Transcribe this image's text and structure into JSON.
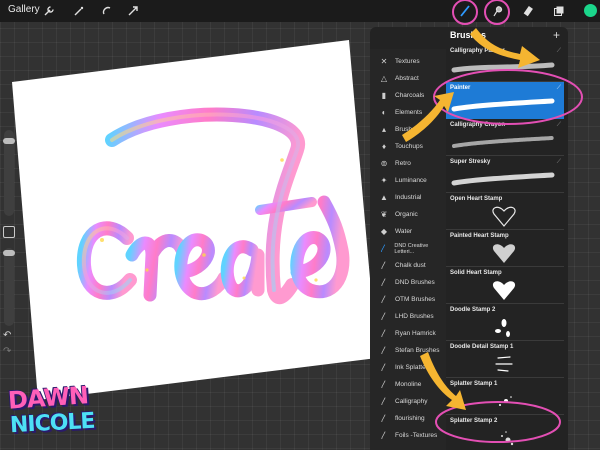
{
  "topbar": {
    "gallery_label": "Gallery",
    "tools": [
      {
        "name": "wrench-icon"
      },
      {
        "name": "magic-wand-icon"
      },
      {
        "name": "selection-icon"
      },
      {
        "name": "transform-arrow-icon"
      },
      {
        "name": "brush-icon"
      },
      {
        "name": "smudge-icon"
      },
      {
        "name": "eraser-icon"
      },
      {
        "name": "layers-icon"
      }
    ],
    "color": "#1bd68b"
  },
  "brush_library": {
    "title": "Brushes",
    "categories": [
      {
        "label": "Textures",
        "icon": "textures-icon"
      },
      {
        "label": "Abstract",
        "icon": "abstract-icon"
      },
      {
        "label": "Charcoals",
        "icon": "charcoals-icon"
      },
      {
        "label": "Elements",
        "icon": "elements-icon"
      },
      {
        "label": "Brushes",
        "icon": "brushes-icon"
      },
      {
        "label": "Touchups",
        "icon": "touchups-icon"
      },
      {
        "label": "Retro",
        "icon": "retro-icon"
      },
      {
        "label": "Luminance",
        "icon": "luminance-icon"
      },
      {
        "label": "Industrial",
        "icon": "industrial-icon"
      },
      {
        "label": "Organic",
        "icon": "organic-icon"
      },
      {
        "label": "Water",
        "icon": "water-icon"
      },
      {
        "label": "DND Creative Letteri...",
        "icon": "brush-set-icon"
      },
      {
        "label": "Chalk dust",
        "icon": "brush-set-icon"
      },
      {
        "label": "DND Brushes",
        "icon": "brush-set-icon"
      },
      {
        "label": "OTM Brushes",
        "icon": "brush-set-icon"
      },
      {
        "label": "LHD Brushes",
        "icon": "brush-set-icon"
      },
      {
        "label": "Ryan Hamrick",
        "icon": "brush-set-icon"
      },
      {
        "label": "Stefan Brushes",
        "icon": "brush-set-icon"
      },
      {
        "label": "Ink Splatter",
        "icon": "brush-set-icon"
      },
      {
        "label": "Monoline",
        "icon": "brush-set-icon"
      },
      {
        "label": "Calligraphy",
        "icon": "brush-set-icon"
      },
      {
        "label": "flourishing",
        "icon": "brush-set-icon"
      },
      {
        "label": "Foils -Textures",
        "icon": "brush-set-icon"
      }
    ],
    "active_category": "DND Creative Letteri...",
    "brushes": [
      {
        "name": "Calligraphy Painter",
        "stroke": "paint"
      },
      {
        "name": "Painter",
        "stroke": "paint-white"
      },
      {
        "name": "Calligraphy Crayon",
        "stroke": "crayon"
      },
      {
        "name": "Super Stresky",
        "stroke": "streaky"
      },
      {
        "name": "Open Heart Stamp",
        "stroke": "open-heart"
      },
      {
        "name": "Painted Heart Stamp",
        "stroke": "painted-heart"
      },
      {
        "name": "Solid Heart Stamp",
        "stroke": "solid-heart"
      },
      {
        "name": "Doodle Stamp 2",
        "stroke": "doodle"
      },
      {
        "name": "Doodle Detail Stamp 1",
        "stroke": "doodle-detail"
      },
      {
        "name": "Splatter Stamp 1",
        "stroke": "splatter"
      },
      {
        "name": "Splatter Stamp 2",
        "stroke": "splatter2"
      }
    ],
    "selected_brush": "Painter",
    "add_icon": "plus-icon",
    "edit_icon": "edit-icon"
  },
  "artwork": {
    "word": "create"
  },
  "logo": {
    "line1": "DAWN",
    "line2": "NICOLE"
  },
  "colors": {
    "annotation": "#e34fb4",
    "arrow": "#f5b531",
    "selection": "#1e7bd6"
  }
}
